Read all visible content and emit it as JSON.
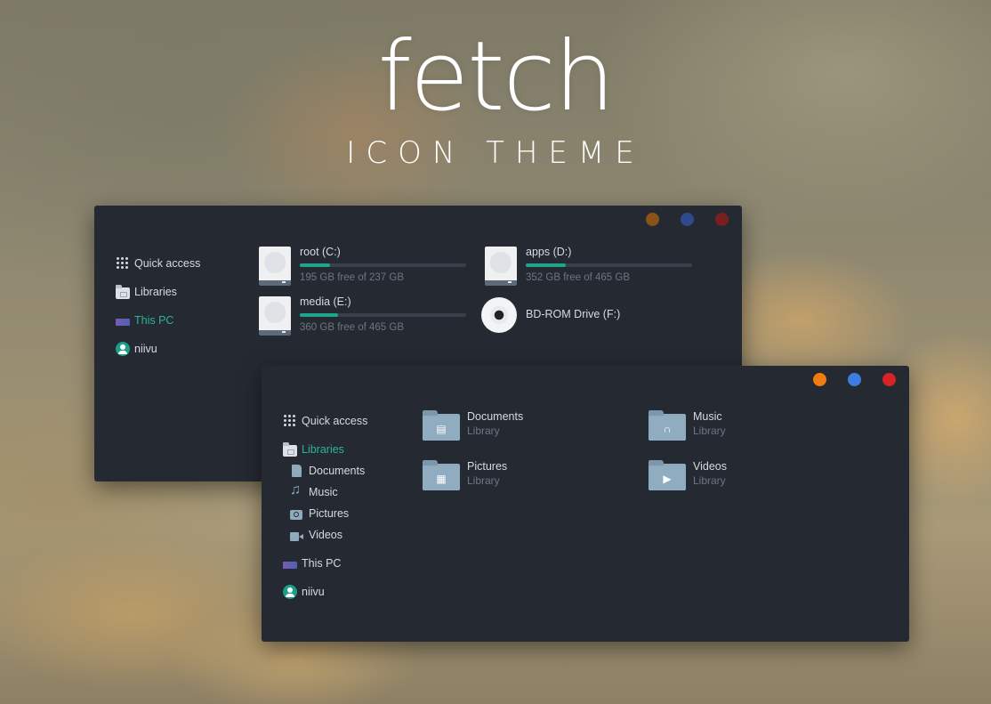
{
  "hero": {
    "title": "fetch",
    "subtitle": "ICON THEME"
  },
  "window_back": {
    "controls": {
      "colors": [
        "#8a5419",
        "#2c4a8c",
        "#7a1f1f"
      ]
    },
    "sidebar": [
      {
        "label": "Quick access",
        "icon": "grid-icon",
        "active": false
      },
      {
        "label": "Libraries",
        "icon": "libraries-icon",
        "active": false
      },
      {
        "label": "This PC",
        "icon": "this-pc-icon",
        "active": true
      },
      {
        "label": "niivu",
        "icon": "user-icon",
        "active": false
      }
    ],
    "drives": [
      {
        "name": "root (C:)",
        "free": "195 GB free of 237 GB",
        "used_fraction": 0.18
      },
      {
        "name": "apps (D:)",
        "free": "352 GB free of 465 GB",
        "used_fraction": 0.24
      },
      {
        "name": "media (E:)",
        "free": "360 GB free of 465 GB",
        "used_fraction": 0.23
      },
      {
        "name": "BD-ROM Drive (F:)",
        "icon": "disc-icon"
      }
    ]
  },
  "window_front": {
    "controls": {
      "colors": [
        "#f07b0e",
        "#3d7de0",
        "#d62424"
      ]
    },
    "sidebar": [
      {
        "label": "Quick access",
        "icon": "grid-icon",
        "active": false
      },
      {
        "label": "Libraries",
        "icon": "libraries-icon",
        "active": true
      },
      {
        "label": "Documents",
        "icon": "document-icon",
        "sub": true
      },
      {
        "label": "Music",
        "icon": "music-icon",
        "sub": true
      },
      {
        "label": "Pictures",
        "icon": "camera-icon",
        "sub": true
      },
      {
        "label": "Videos",
        "icon": "video-icon",
        "sub": true
      },
      {
        "label": "This PC",
        "icon": "this-pc-icon",
        "active": false
      },
      {
        "label": "niivu",
        "icon": "user-icon",
        "active": false
      }
    ],
    "libraries": [
      {
        "name": "Documents",
        "type": "Library",
        "glyph": "document"
      },
      {
        "name": "Music",
        "type": "Library",
        "glyph": "headphones"
      },
      {
        "name": "Pictures",
        "type": "Library",
        "glyph": "image"
      },
      {
        "name": "Videos",
        "type": "Library",
        "glyph": "video"
      }
    ]
  },
  "colors": {
    "accent": "#1fa58b",
    "window_bg": "#252932",
    "folder": "#8fa9bd"
  }
}
